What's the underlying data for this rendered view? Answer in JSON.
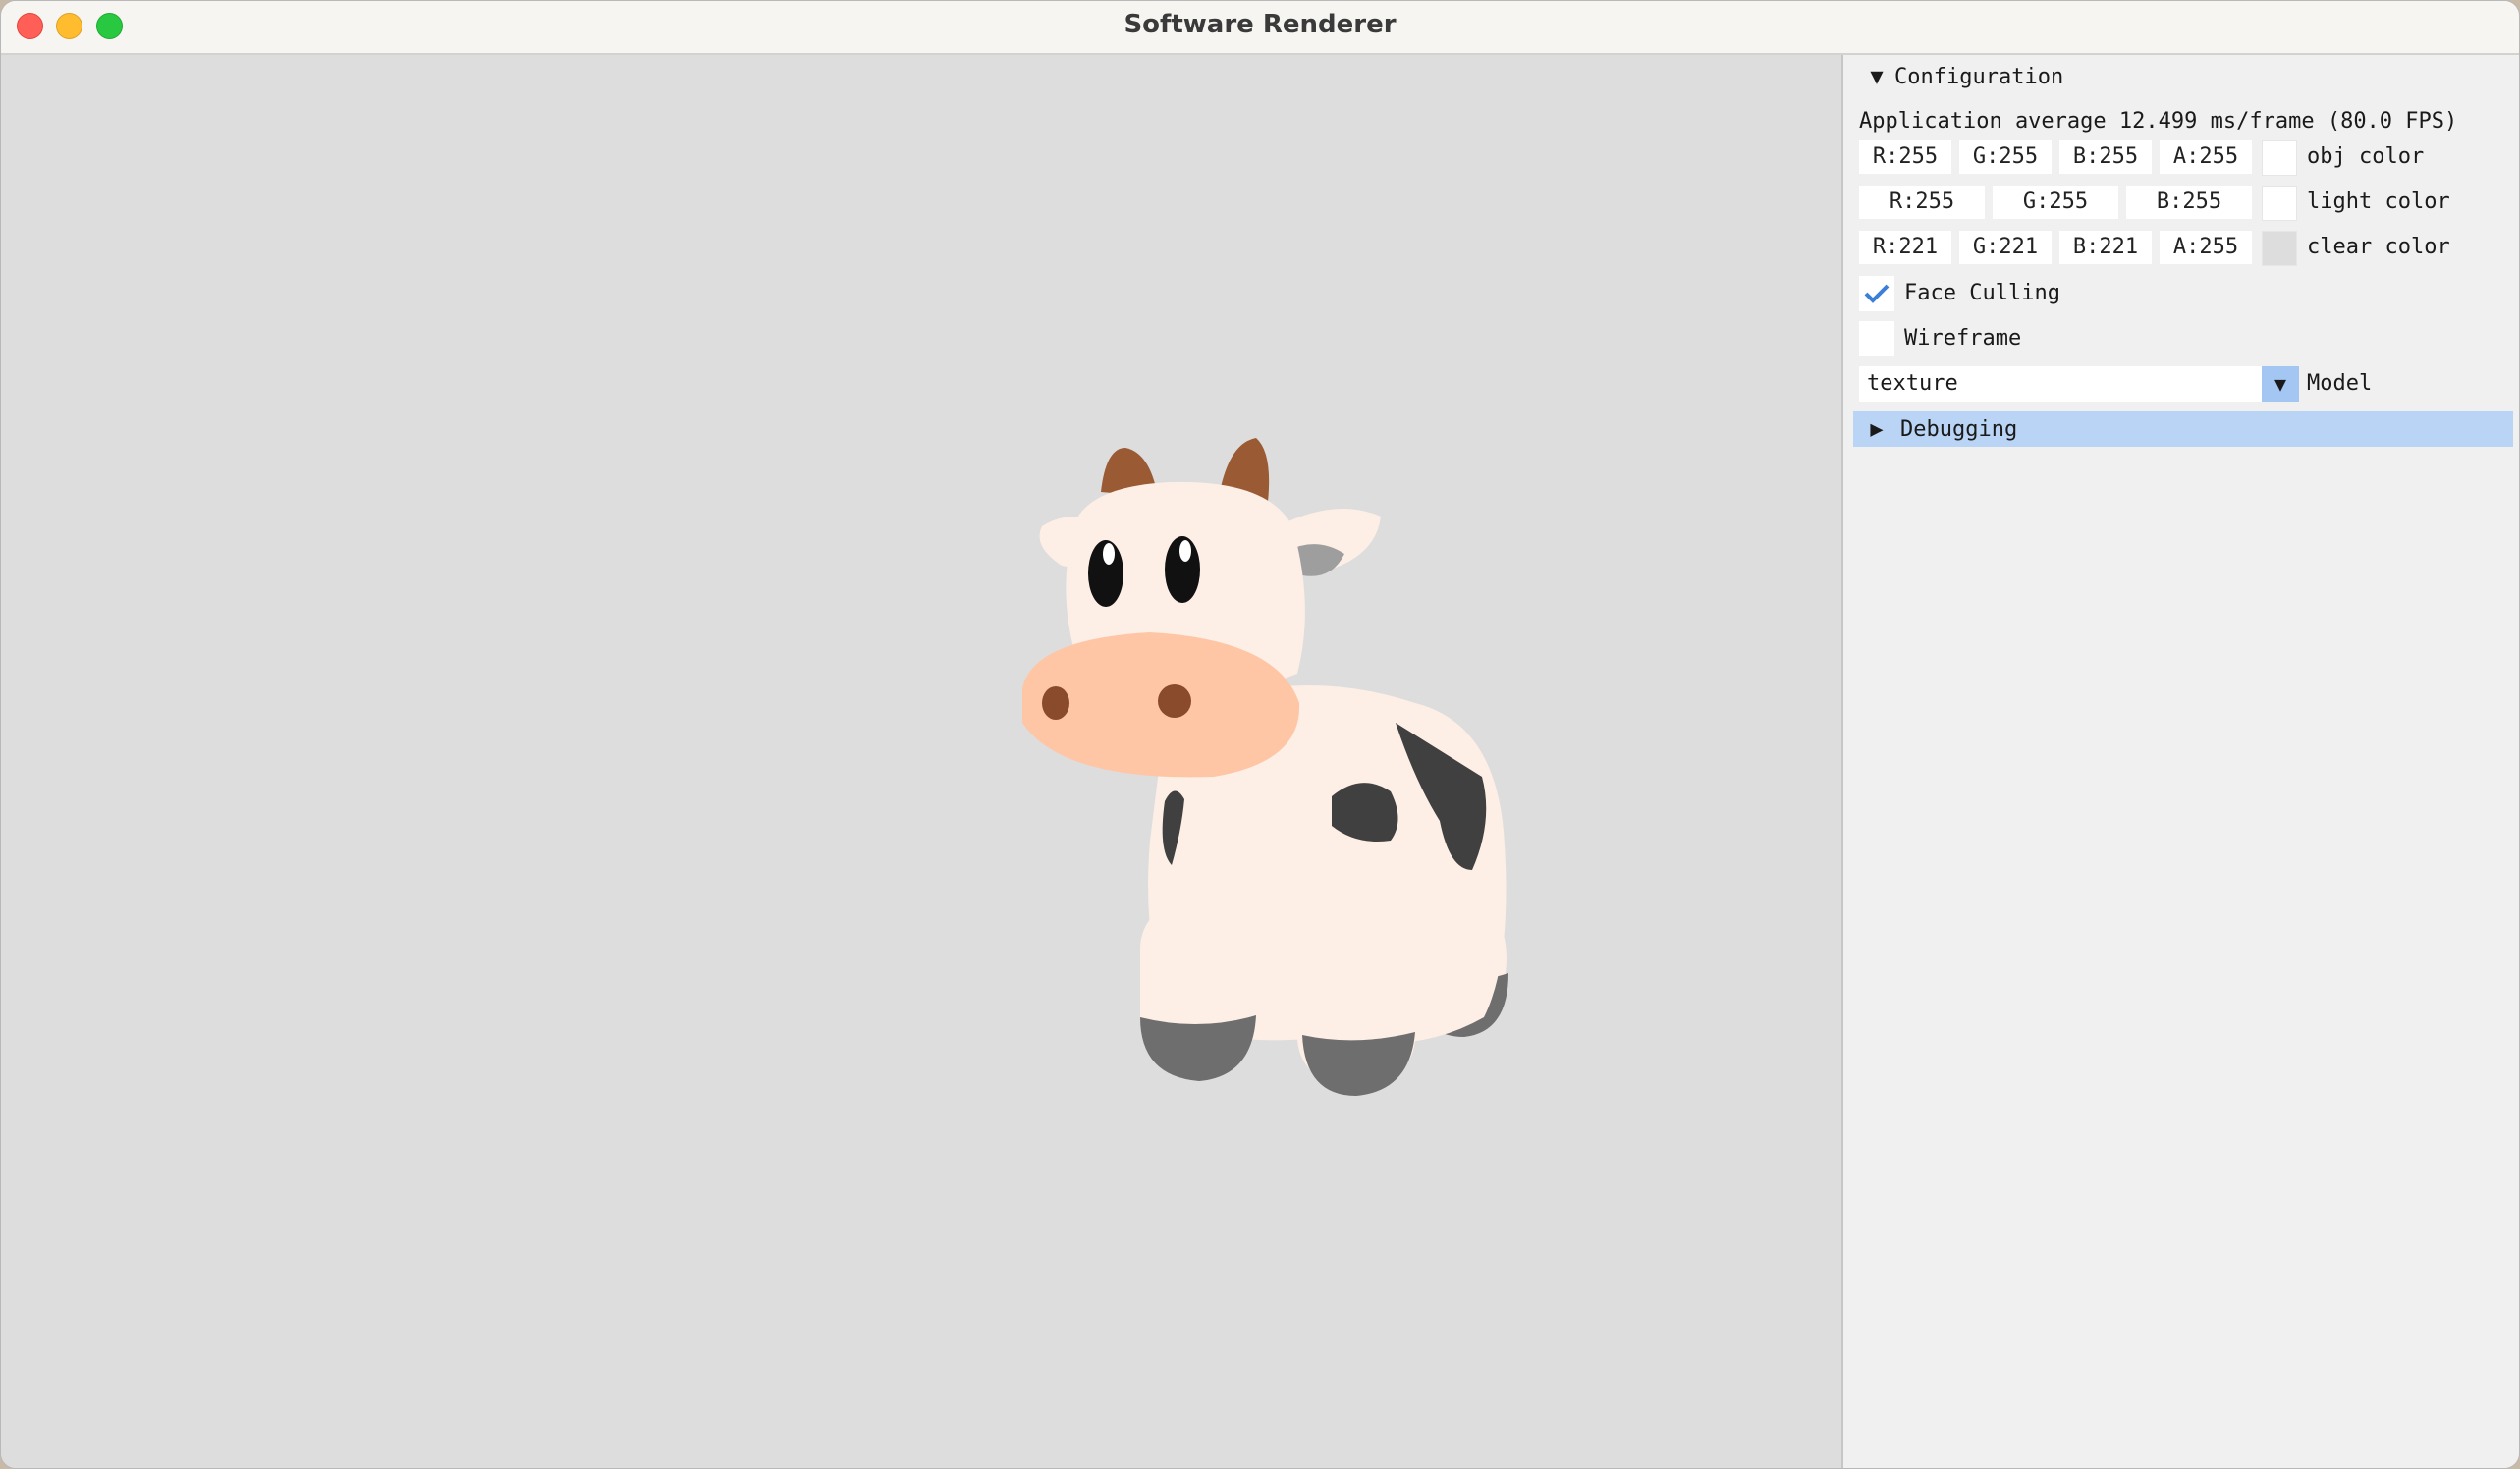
{
  "window": {
    "title": "Software Renderer"
  },
  "viewport": {
    "clear_color": "#dddddd",
    "model_depicted": "cow"
  },
  "panel": {
    "configuration": {
      "arrow": "▼",
      "label": "Configuration"
    },
    "fps_text": "Application average 12.499 ms/frame (80.0 FPS)",
    "obj_color": {
      "r": "R:255",
      "g": "G:255",
      "b": "B:255",
      "a": "A:255",
      "swatch": "#ffffff",
      "label": "obj color"
    },
    "light_color": {
      "r": "R:255",
      "g": "G:255",
      "b": "B:255",
      "swatch": "#ffffff",
      "label": "light color"
    },
    "clear_color": {
      "r": "R:221",
      "g": "G:221",
      "b": "B:221",
      "a": "A:255",
      "swatch": "#dddddd",
      "label": "clear color"
    },
    "face_culling": {
      "label": "Face Culling",
      "checked": true
    },
    "wireframe": {
      "label": "Wireframe",
      "checked": false
    },
    "model": {
      "value": "texture",
      "label": "Model",
      "arrow": "▼"
    },
    "debugging": {
      "arrow": "▶",
      "label": "Debugging"
    }
  },
  "colors": {
    "accent": "#3b7fd6",
    "header_highlight": "#b9d4f4",
    "panel_bg": "#f0f0f0"
  }
}
